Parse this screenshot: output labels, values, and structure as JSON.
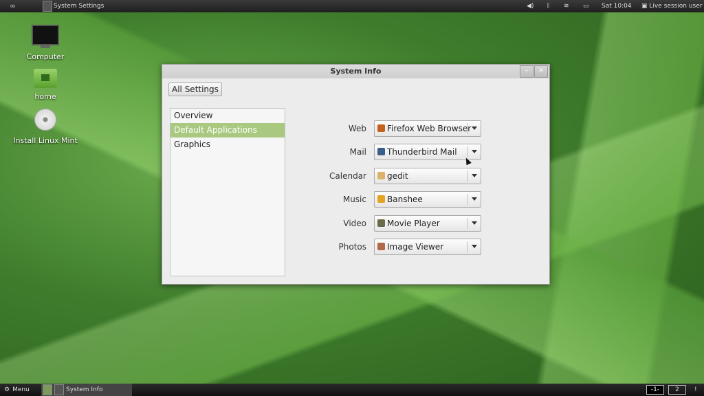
{
  "top_panel": {
    "app_title": "System Settings",
    "clock": "Sat 10:04",
    "session_user": "Live session user"
  },
  "desktop_icons": [
    {
      "label": "Computer"
    },
    {
      "label": "home"
    },
    {
      "label": "Install Linux Mint"
    }
  ],
  "window": {
    "title": "System Info",
    "all_settings_label": "All Settings",
    "sidebar": [
      {
        "label": "Overview"
      },
      {
        "label": "Default Applications"
      },
      {
        "label": "Graphics"
      }
    ],
    "defaults": [
      {
        "label": "Web",
        "value": "Firefox Web Browser",
        "icon_color": "#c4611d"
      },
      {
        "label": "Mail",
        "value": "Thunderbird Mail",
        "icon_color": "#3a5e8a"
      },
      {
        "label": "Calendar",
        "value": "gedit",
        "icon_color": "#d9b46a"
      },
      {
        "label": "Music",
        "value": "Banshee",
        "icon_color": "#e2a422"
      },
      {
        "label": "Video",
        "value": "Movie Player",
        "icon_color": "#6b6b4b"
      },
      {
        "label": "Photos",
        "value": "Image Viewer",
        "icon_color": "#b06a4a"
      }
    ]
  },
  "bottom_panel": {
    "menu_label": "Menu",
    "task_label": "System Info",
    "workspaces": [
      "-1-",
      "2"
    ],
    "notify": "!"
  }
}
